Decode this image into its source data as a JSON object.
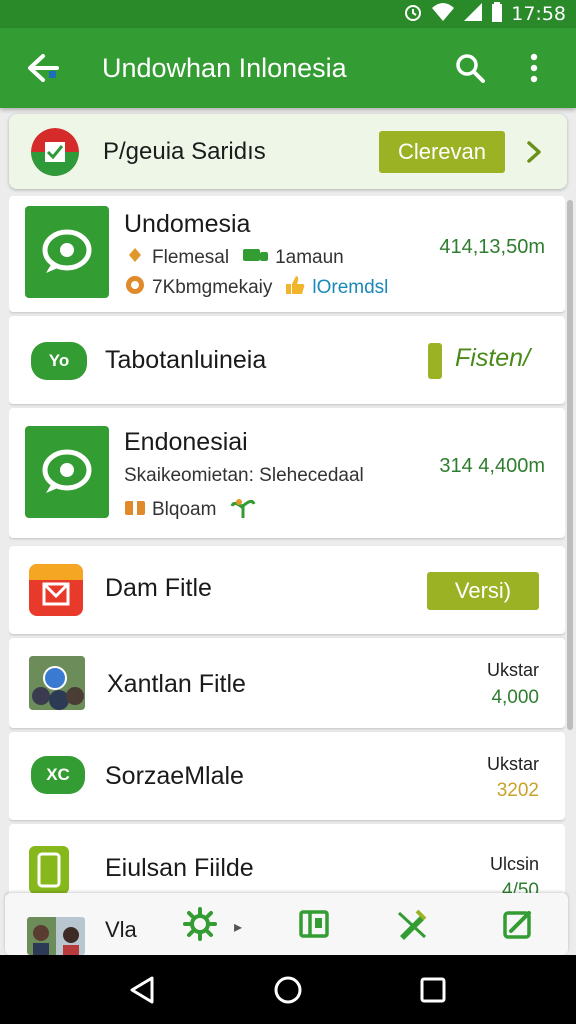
{
  "status_bar": {
    "time": "17:58",
    "icons": [
      "alarm-icon",
      "wifi-icon",
      "signal-icon",
      "battery-icon"
    ]
  },
  "app_bar": {
    "title": "Undowhan Inlonesia",
    "icons": [
      "back-arrow-icon",
      "search-icon",
      "more-vert-icon"
    ]
  },
  "banner": {
    "name": "P/geuia Saridıs",
    "button_label": "Clerevan",
    "icon": "chevron-right-icon"
  },
  "list": {
    "items": [
      {
        "title": "Undomesia",
        "meta1": [
          "Flemesal",
          "1amaun"
        ],
        "meta2": [
          "7Kbmgmekaiy",
          "lOremdsl"
        ],
        "value": "414,13,50m"
      },
      {
        "icon_text": "Yo",
        "title": "Tabotanluineia",
        "button_label": "Fisten/"
      },
      {
        "title": "Endonesiai",
        "meta1": [
          "Skaikeomietan: Slehecedaal"
        ],
        "meta2": [
          "Blqoam"
        ],
        "value": "314 4,400m"
      },
      {
        "title": "Dam Fitle",
        "button_label": "Versi)"
      },
      {
        "title": "Xantlan Fitle",
        "label": "Ukstar",
        "value": "4,000"
      },
      {
        "icon_text": "XC",
        "title": "SorzaeMlale",
        "label": "Ukstar",
        "value": "3202"
      },
      {
        "title": "Eiulsan Fiilde",
        "label": "Ulcsin",
        "value": "4/50"
      }
    ]
  },
  "toolbar": {
    "label": "Vla",
    "icons": [
      "settings-icon",
      "book-icon",
      "edit-pen-icon",
      "compose-icon"
    ]
  },
  "colors": {
    "primary": "#339c33",
    "accent": "#9ab223",
    "value_green": "#2f7d2f",
    "value_gold": "#c9a22a",
    "link_blue": "#1a88b8"
  }
}
